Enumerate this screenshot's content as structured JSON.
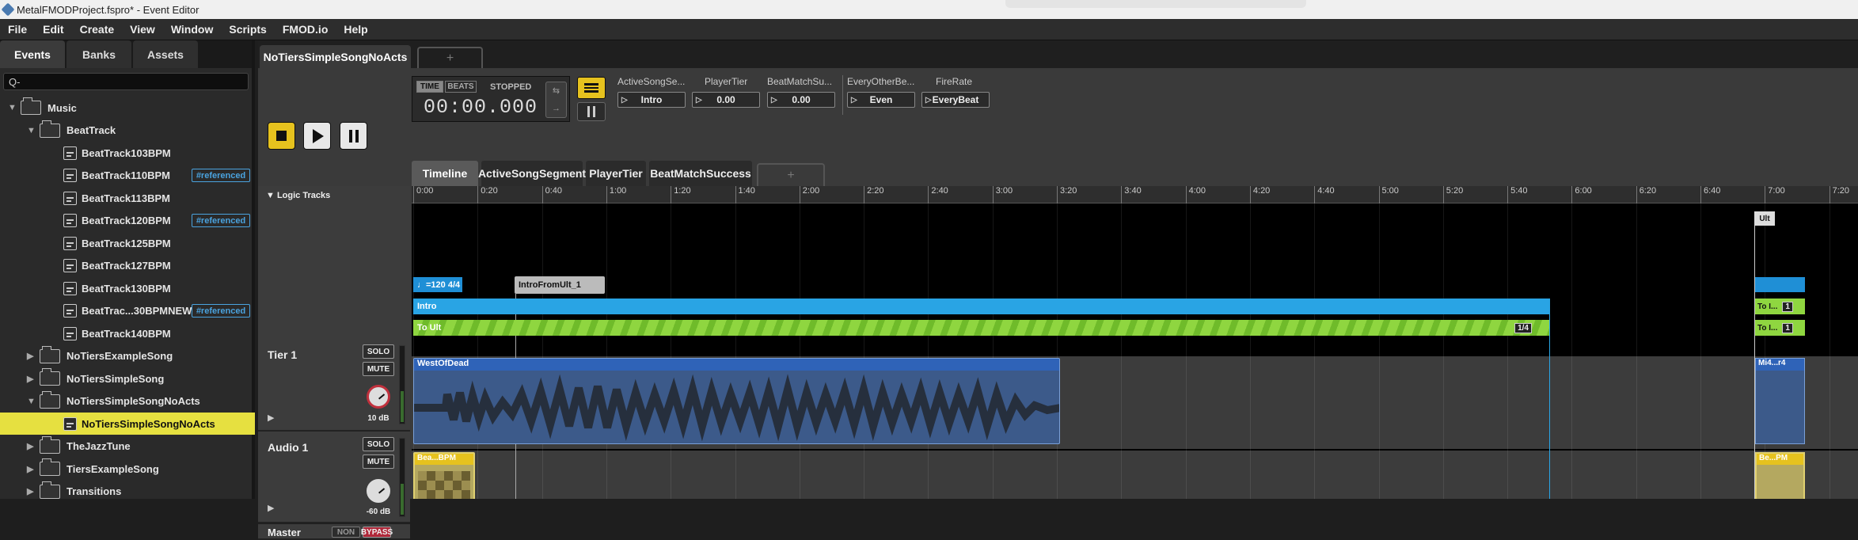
{
  "window": {
    "title": "MetalFMODProject.fspro* - Event Editor"
  },
  "menu": [
    "File",
    "Edit",
    "Create",
    "View",
    "Window",
    "Scripts",
    "FMOD.io",
    "Help"
  ],
  "browser": {
    "tabs": [
      "Events",
      "Banks",
      "Assets"
    ],
    "search_placeholder": "Q-",
    "tree": [
      {
        "label": "Music",
        "type": "folder",
        "depth": 0,
        "expanded": true
      },
      {
        "label": "BeatTrack",
        "type": "folder",
        "depth": 1,
        "expanded": true
      },
      {
        "label": "BeatTrack103BPM",
        "type": "event",
        "depth": 2
      },
      {
        "label": "BeatTrack110BPM",
        "type": "event",
        "depth": 2,
        "badge": "#referenced"
      },
      {
        "label": "BeatTrack113BPM",
        "type": "event",
        "depth": 2
      },
      {
        "label": "BeatTrack120BPM",
        "type": "event",
        "depth": 2,
        "badge": "#referenced"
      },
      {
        "label": "BeatTrack125BPM",
        "type": "event",
        "depth": 2
      },
      {
        "label": "BeatTrack127BPM",
        "type": "event",
        "depth": 2
      },
      {
        "label": "BeatTrack130BPM",
        "type": "event",
        "depth": 2
      },
      {
        "label": "BeatTrac...30BPMNEW",
        "type": "event",
        "depth": 2,
        "badge": "#referenced"
      },
      {
        "label": "BeatTrack140BPM",
        "type": "event",
        "depth": 2
      },
      {
        "label": "NoTiersExampleSong",
        "type": "folder",
        "depth": 1,
        "expanded": false
      },
      {
        "label": "NoTiersSimpleSong",
        "type": "folder",
        "depth": 1,
        "expanded": false
      },
      {
        "label": "NoTiersSimpleSongNoActs",
        "type": "folder",
        "depth": 1,
        "expanded": true
      },
      {
        "label": "NoTiersSimpleSongNoActs",
        "type": "event",
        "depth": 2,
        "selected": true
      },
      {
        "label": "TheJazzTune",
        "type": "folder",
        "depth": 1,
        "expanded": false
      },
      {
        "label": "TiersExampleSong",
        "type": "folder",
        "depth": 1,
        "expanded": false
      },
      {
        "label": "Transitions",
        "type": "folder",
        "depth": 1,
        "expanded": false
      }
    ]
  },
  "editor": {
    "tab": "NoTiersSimpleSongNoActs",
    "add_tab": "+",
    "transport": {
      "mode_time": "TIME",
      "mode_beats": "BEATS",
      "state": "STOPPED",
      "time": "00:00.000"
    },
    "parameters": [
      {
        "name": "ActiveSongSe...",
        "value": "Intro"
      },
      {
        "name": "PlayerTier",
        "value": "0.00"
      },
      {
        "name": "BeatMatchSu...",
        "value": "0.00"
      },
      {
        "name": "EveryOtherBe...",
        "value": "Even"
      },
      {
        "name": "FireRate",
        "value": "EveryBeat"
      }
    ],
    "subtabs": [
      "Timeline",
      "ActiveSongSegment",
      "PlayerTier",
      "BeatMatchSuccess"
    ],
    "logic_tracks_label": "Logic Tracks",
    "ruler": [
      "0:00",
      "0:20",
      "0:40",
      "1:00",
      "1:20",
      "1:40",
      "2:00",
      "2:20",
      "2:40",
      "3:00",
      "3:20",
      "3:40",
      "4:00",
      "4:20",
      "4:40",
      "5:00",
      "5:20",
      "5:40",
      "6:00",
      "6:20",
      "6:40",
      "7:00",
      "7:20"
    ],
    "markers": {
      "tempo": "♩=120 4/4",
      "destination": "IntroFromUlt_1",
      "region_intro": "Intro",
      "region_toult": "To Ult",
      "toult_count": "1/4",
      "ult_label": "Ult",
      "right_region_1": "To I...",
      "right_region_2": "To I...",
      "right_count": "1"
    },
    "tracks": [
      {
        "name": "Tier 1",
        "solo": "SOLO",
        "mute": "MUTE",
        "volume": "10 dB",
        "instrument": "WestOfDead",
        "instrument_right": "Mi4...r4"
      },
      {
        "name": "Audio 1",
        "solo": "SOLO",
        "mute": "MUTE",
        "volume": "-60 dB",
        "instrument": "Bea...BPM",
        "instrument_right": "Be...PM"
      },
      {
        "name": "Master",
        "solo": "NON",
        "mute": "BYPASS"
      }
    ]
  }
}
